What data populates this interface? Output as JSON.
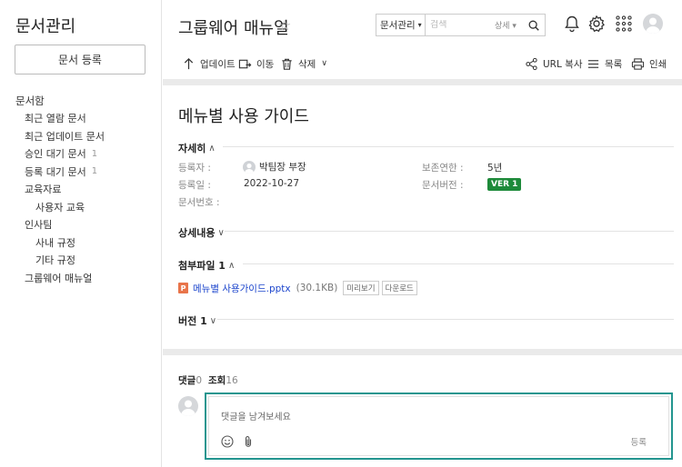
{
  "sidebar": {
    "title": "문서관리",
    "register_label": "문서 등록",
    "items": [
      {
        "label": "문서함",
        "level": 0,
        "count": ""
      },
      {
        "label": "최근 열람 문서",
        "level": 1,
        "count": ""
      },
      {
        "label": "최근 업데이트 문서",
        "level": 1,
        "count": ""
      },
      {
        "label": "승인 대기 문서",
        "level": 1,
        "count": "1"
      },
      {
        "label": "등록 대기 문서",
        "level": 1,
        "count": "1"
      },
      {
        "label": "교육자료",
        "level": 1,
        "count": ""
      },
      {
        "label": "사용자 교육",
        "level": 2,
        "count": ""
      },
      {
        "label": "인사팀",
        "level": 1,
        "count": ""
      },
      {
        "label": "사내 규정",
        "level": 2,
        "count": ""
      },
      {
        "label": "기타 규정",
        "level": 2,
        "count": ""
      },
      {
        "label": "그룹웨어 매뉴얼",
        "level": 1,
        "count": ""
      }
    ]
  },
  "header": {
    "title": "그룹웨어 매뉴얼",
    "search": {
      "scope": "문서관리",
      "placeholder": "검색",
      "detail": "상세"
    }
  },
  "toolbar": {
    "update": "업데이트",
    "move": "이동",
    "delete": "삭제",
    "url_copy": "URL 복사",
    "list": "목록",
    "print": "인쇄"
  },
  "document": {
    "title": "메뉴별 사용 가이드",
    "details_label": "자세히",
    "meta": {
      "registrant_label": "등록자 :",
      "registrant": "박팀장 부장",
      "date_label": "등록일 :",
      "date": "2022-10-27",
      "docno_label": "문서번호 :",
      "retention_label": "보존연한 :",
      "retention": "5년",
      "version_label": "문서버전 :",
      "version": "VER 1"
    },
    "content_label": "상세내용",
    "attachments_label": "첨부파일 1",
    "file": {
      "name": "메뉴별 사용가이드.pptx",
      "size": "(30.1KB)",
      "preview": "미리보기",
      "download": "다운로드",
      "icon_letter": "P"
    },
    "versions_label": "버전 1"
  },
  "comments": {
    "comment_label": "댓글",
    "comment_count": "0",
    "views_label": "조회",
    "views_count": "16",
    "placeholder": "댓글을 남겨보세요",
    "submit": "등록"
  },
  "colors": {
    "accent": "#23958f",
    "badge": "#1e8a3a",
    "link": "#1b44cc"
  }
}
